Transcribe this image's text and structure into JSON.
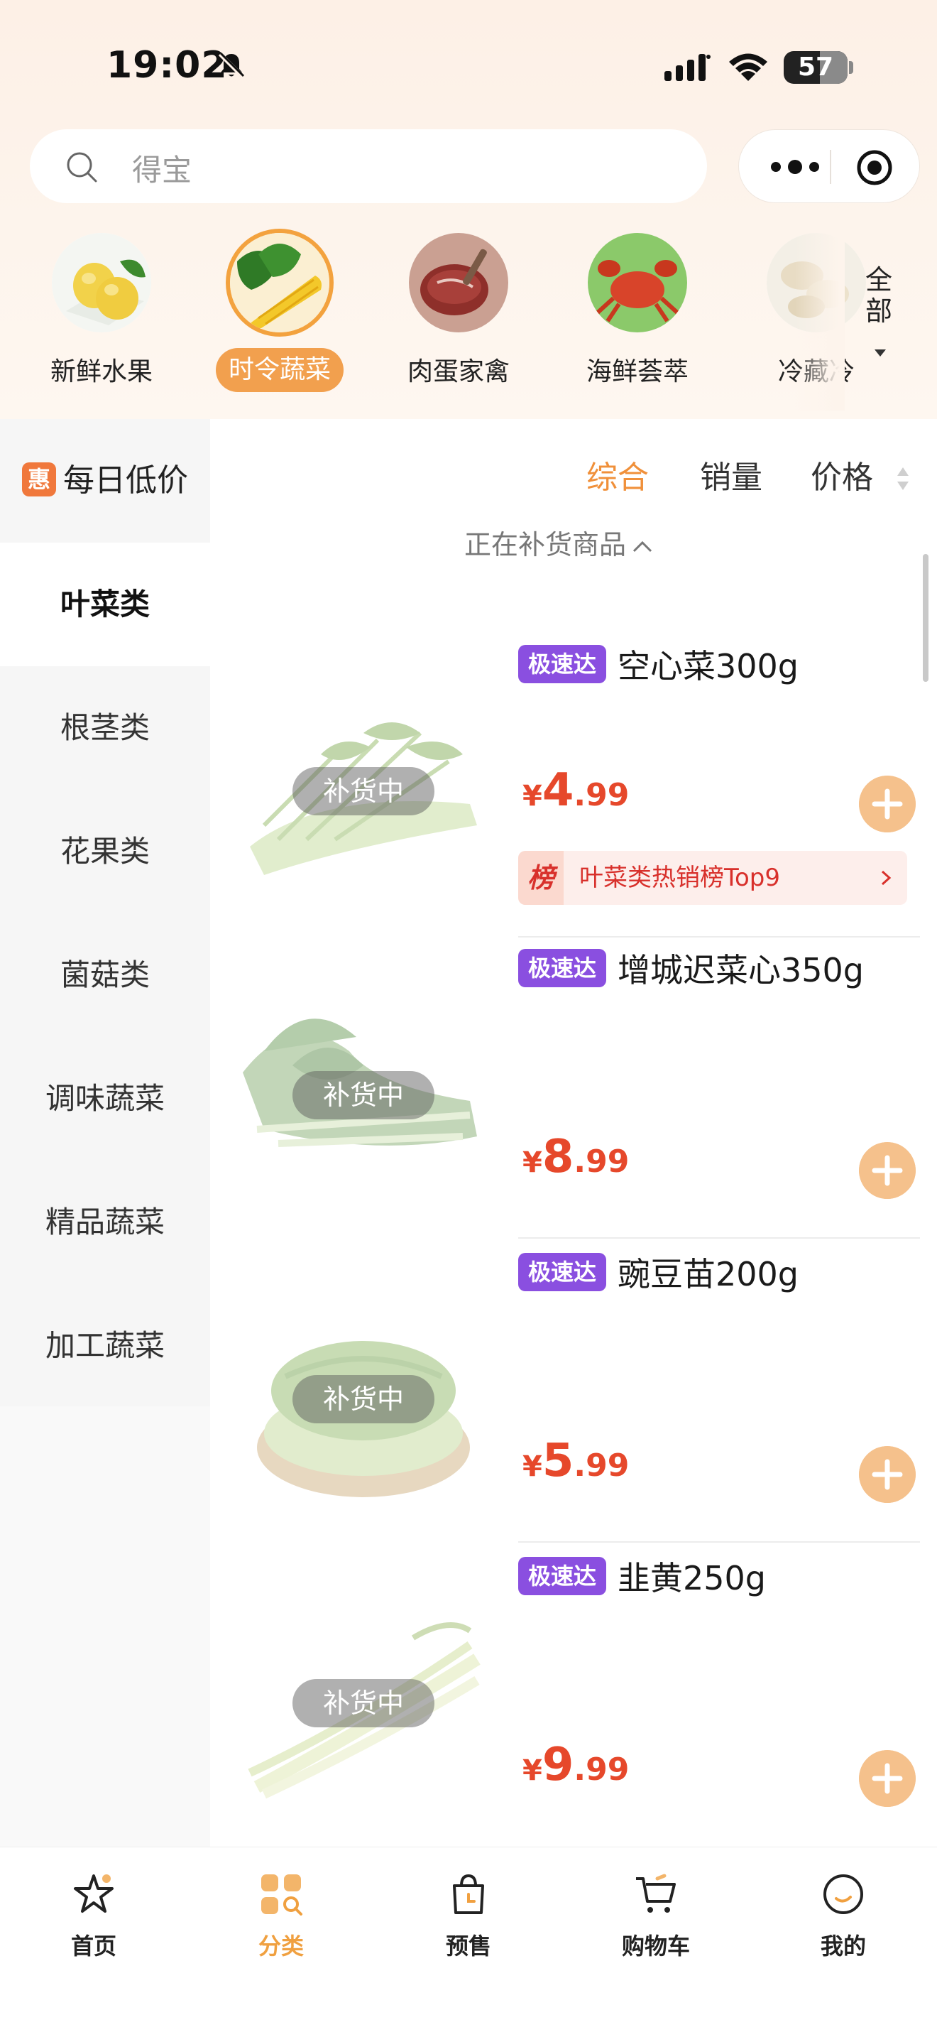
{
  "status_bar": {
    "time": "19:02",
    "battery": "57",
    "battery_level": 0.57
  },
  "search": {
    "placeholder": "得宝"
  },
  "categories": [
    {
      "label": "新鲜水果",
      "icon": "pear-photo"
    },
    {
      "label": "时令蔬菜",
      "icon": "vegetables-photo",
      "active": true
    },
    {
      "label": "肉蛋家禽",
      "icon": "meat-photo"
    },
    {
      "label": "海鲜荟萃",
      "icon": "crab-photo"
    },
    {
      "label": "冷藏冷",
      "icon": "dumplings-photo"
    }
  ],
  "categories_all": "全部",
  "sidebar": {
    "promo": {
      "badge": "惠",
      "label": "每日低价"
    },
    "items": [
      "叶菜类",
      "根茎类",
      "花果类",
      "菌菇类",
      "调味蔬菜",
      "精品蔬菜",
      "加工蔬菜"
    ],
    "active_index": 0
  },
  "sort": {
    "options": [
      "综合",
      "销量",
      "价格"
    ],
    "active_index": 0
  },
  "restock_note": "正在补货商品",
  "products": [
    {
      "tag": "极速达",
      "name": "空心菜300g",
      "price_symbol": "¥",
      "price_int": "4",
      "price_dec": ".99",
      "status": "补货中",
      "rank_mark": "榜",
      "rank_text": "叶菜类热销榜Top9"
    },
    {
      "tag": "极速达",
      "name": "增城迟菜心350g",
      "price_symbol": "¥",
      "price_int": "8",
      "price_dec": ".99",
      "status": "补货中"
    },
    {
      "tag": "极速达",
      "name": "豌豆苗200g",
      "price_symbol": "¥",
      "price_int": "5",
      "price_dec": ".99",
      "status": "补货中"
    },
    {
      "tag": "极速达",
      "name": "韭黄250g",
      "price_symbol": "¥",
      "price_int": "9",
      "price_dec": ".99",
      "status": "补货中"
    }
  ],
  "bottom_nav": [
    {
      "label": "首页",
      "icon": "home-icon"
    },
    {
      "label": "分类",
      "icon": "category-icon",
      "active": true
    },
    {
      "label": "预售",
      "icon": "presale-bag-icon"
    },
    {
      "label": "购物车",
      "icon": "cart-icon"
    },
    {
      "label": "我的",
      "icon": "profile-icon"
    }
  ],
  "colors": {
    "accent": "#f0903a",
    "price": "#e6482b",
    "express_tag": "#8a4fe0",
    "add_button": "#f5c18c"
  }
}
